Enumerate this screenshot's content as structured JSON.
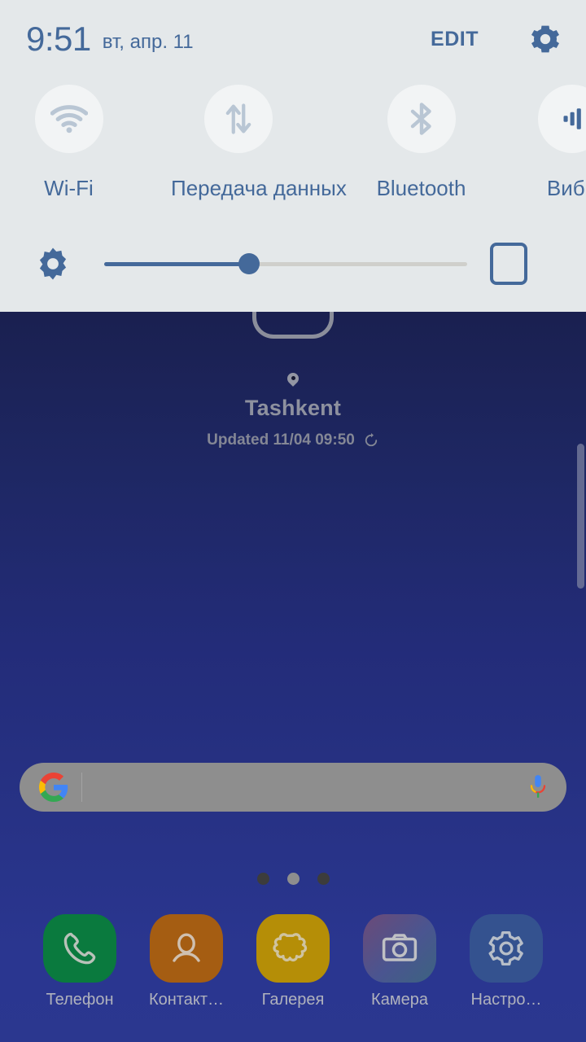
{
  "quick_settings": {
    "clock": {
      "time": "9:51",
      "date": "вт, апр. 11"
    },
    "edit_label": "EDIT",
    "settings_icon": "gear-icon",
    "accent_color": "#44699a",
    "panel_bg": "#e4e8ea",
    "tiles": [
      {
        "label": "Wi-Fi",
        "icon": "wifi-icon",
        "state": "off"
      },
      {
        "label": "Передача данных",
        "icon": "data-transfer-icon",
        "state": "off"
      },
      {
        "label": "Bluetooth",
        "icon": "bluetooth-icon",
        "state": "off"
      },
      {
        "label": "Вибр",
        "icon": "vibrate-icon",
        "state": "on"
      }
    ],
    "brightness": {
      "icon": "brightness-sun-icon",
      "value_percent": 40,
      "auto_toggle_label": "auto-brightness-toggle",
      "auto_toggle_checked": false
    }
  },
  "home": {
    "weather": {
      "icon": "weather-cloud-icon",
      "location_icon": "location-pin-icon",
      "city": "Tashkent",
      "updated": "Updated 11/04 09:50",
      "refresh_icon": "refresh-icon"
    },
    "search": {
      "logo": "google-g-logo",
      "value": "",
      "placeholder": "",
      "mic_icon": "microphone-icon"
    },
    "page_dots": {
      "count": 3,
      "active_index": 1
    },
    "dock": [
      {
        "label": "Телефон",
        "icon": "phone-icon",
        "color": "#0a7a3e"
      },
      {
        "label": "Контакт…",
        "icon": "contacts-icon",
        "color": "#a55d12"
      },
      {
        "label": "Галерея",
        "icon": "gallery-icon",
        "color": "#b58e07"
      },
      {
        "label": "Камера",
        "icon": "camera-icon",
        "color": "#4a5590"
      },
      {
        "label": "Настро…",
        "icon": "settings-icon",
        "color": "#34528f"
      }
    ]
  }
}
